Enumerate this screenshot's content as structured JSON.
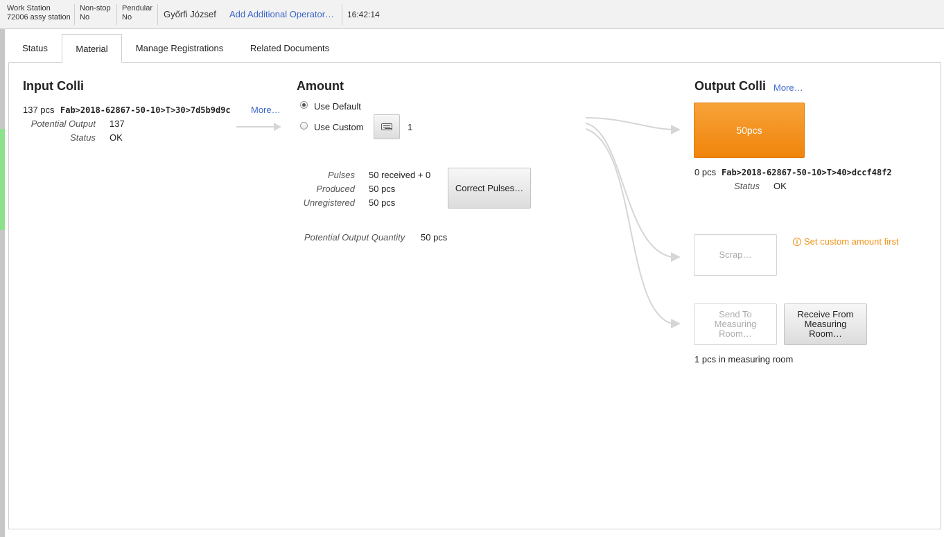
{
  "topbar": {
    "workstation_label": "Work Station",
    "workstation_value": "72006 assy station",
    "nonstop_label": "Non-stop",
    "nonstop_value": "No",
    "pendular_label": "Pendular",
    "pendular_value": "No",
    "operator": "Győrfi József",
    "add_operator": "Add Additional Operator…",
    "time": "16:42:14"
  },
  "tabs": [
    {
      "label": "Status"
    },
    {
      "label": "Material"
    },
    {
      "label": "Manage Registrations"
    },
    {
      "label": "Related Documents"
    }
  ],
  "input_colli": {
    "title": "Input Colli",
    "pcs": "137 pcs",
    "code": "Fab>2018-62867-50-10>T>30>7d5b9d9c",
    "more": "More…",
    "potential_output_label": "Potential Output",
    "potential_output_value": "137",
    "status_label": "Status",
    "status_value": "OK"
  },
  "amount": {
    "title": "Amount",
    "use_default": "Use Default",
    "use_custom": "Use Custom",
    "custom_value": "1",
    "pulses_label": "Pulses",
    "pulses_value": "50 received + 0",
    "produced_label": "Produced",
    "produced_value": "50 pcs",
    "unregistered_label": "Unregistered",
    "unregistered_value": "50 pcs",
    "correct_pulses": "Correct Pulses…",
    "potential_output_qty_label": "Potential Output Quantity",
    "potential_output_qty_value": "50 pcs"
  },
  "output_colli": {
    "title": "Output Colli",
    "more": "More…",
    "main_button": "50pcs",
    "pcs": "0 pcs",
    "code": "Fab>2018-62867-50-10>T>40>dccf48f2",
    "status_label": "Status",
    "status_value": "OK",
    "scrap": "Scrap…",
    "scrap_warning": "Set custom amount first",
    "send_to_measuring": "Send To Measuring Room…",
    "receive_from_measuring": "Receive From Measuring Room…",
    "measuring_info": "1 pcs in measuring room"
  },
  "colors": {
    "accent_orange": "#f0850a",
    "link_blue": "#3c66c8",
    "warning_orange": "#f0931c",
    "indicator_green": "#8be28b"
  }
}
